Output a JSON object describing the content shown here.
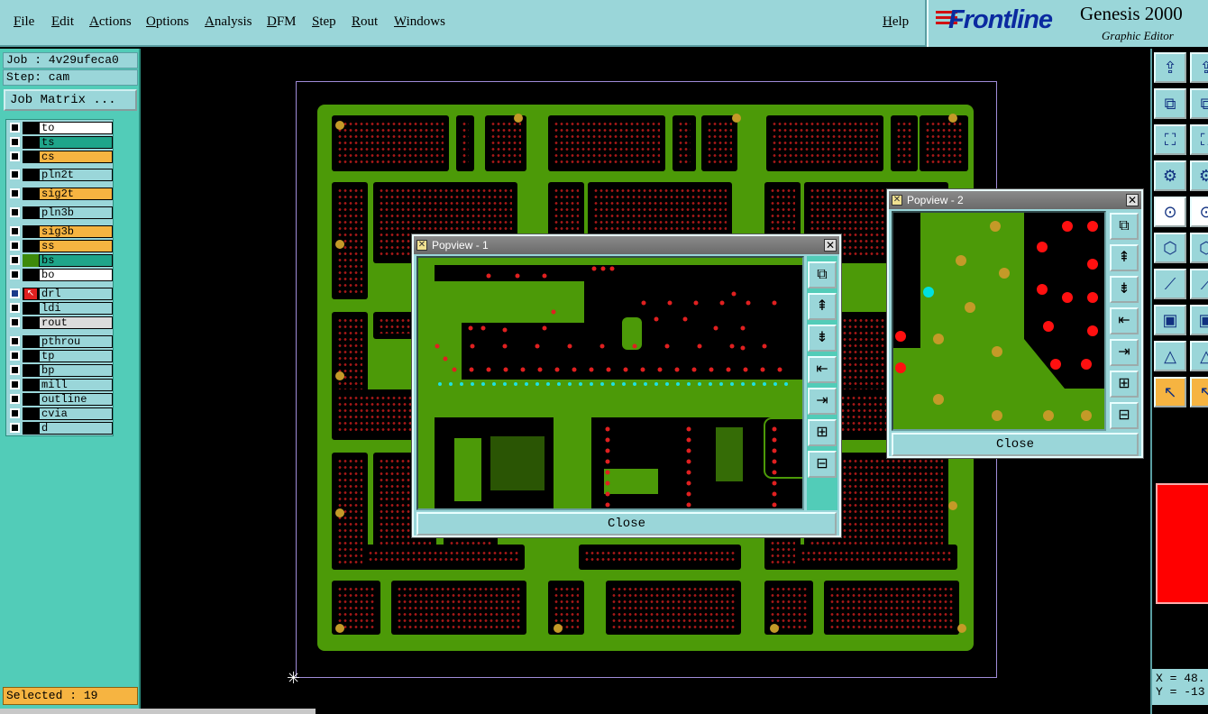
{
  "menu": {
    "items": [
      "File",
      "Edit",
      "Actions",
      "Options",
      "Analysis",
      "DFM",
      "Step",
      "Rout",
      "Windows"
    ],
    "help": "Help"
  },
  "brand": {
    "logo": "Frontline",
    "product": "Genesis 2000",
    "subtitle": "Graphic Editor"
  },
  "job": {
    "job_label": "Job : 4v29ufeca0",
    "step_label": "Step: cam",
    "matrix_button": "Job Matrix ..."
  },
  "layers": [
    {
      "name": "to",
      "color": "#ffffff"
    },
    {
      "name": "ts",
      "color": "#1fa58a"
    },
    {
      "name": "cs",
      "color": "#f6b441"
    },
    {
      "name": "pln2t",
      "color": "#9ad6d9"
    },
    {
      "name": "sig2t",
      "color": "#f6b441"
    },
    {
      "name": "pln3b",
      "color": "#9ad6d9"
    },
    {
      "name": "sig3b",
      "color": "#f6b441"
    },
    {
      "name": "ss",
      "color": "#f6b441"
    },
    {
      "name": "bs",
      "color": "#1fa58a"
    },
    {
      "name": "bo",
      "color": "#ffffff"
    },
    {
      "name": "drl",
      "color": "#9ad6d9"
    },
    {
      "name": "ldi",
      "color": "#9ad6d9"
    },
    {
      "name": "rout",
      "color": "#dcdcdc"
    },
    {
      "name": "pthrou",
      "color": "#9ad6d9"
    },
    {
      "name": "tp",
      "color": "#9ad6d9"
    },
    {
      "name": "bp",
      "color": "#9ad6d9"
    },
    {
      "name": "mill",
      "color": "#9ad6d9"
    },
    {
      "name": "outline",
      "color": "#9ad6d9"
    },
    {
      "name": "cvia",
      "color": "#9ad6d9"
    },
    {
      "name": "d",
      "color": "#9ad6d9"
    }
  ],
  "status": {
    "selected": "Selected : 19"
  },
  "popview1": {
    "title": "Popview - 1",
    "close_label": "Close"
  },
  "popview2": {
    "title": "Popview - 2",
    "close_label": "Close"
  },
  "coords": {
    "x": "X = 48.",
    "y": "Y = -13"
  },
  "colors": {
    "board_green": "#4c9a08",
    "pad_red": "#e02020",
    "pad_yellow": "#c49a28",
    "panel_teal": "#52ccb8",
    "ui_cyan": "#9ad6d9"
  },
  "icons": {
    "popview_tools": [
      "zoom-fit-icon",
      "layer-up-icon",
      "layer-down-icon",
      "pan-left-icon",
      "pan-right-icon",
      "zoom-in-icon",
      "zoom-out-icon"
    ],
    "right_tools": [
      "move-up-icon",
      "copy-icon",
      "fit-icon",
      "setup-icon",
      "snap-icon",
      "network-icon",
      "line-icon",
      "shape-icon",
      "angle-icon",
      "cursor-icon"
    ]
  }
}
